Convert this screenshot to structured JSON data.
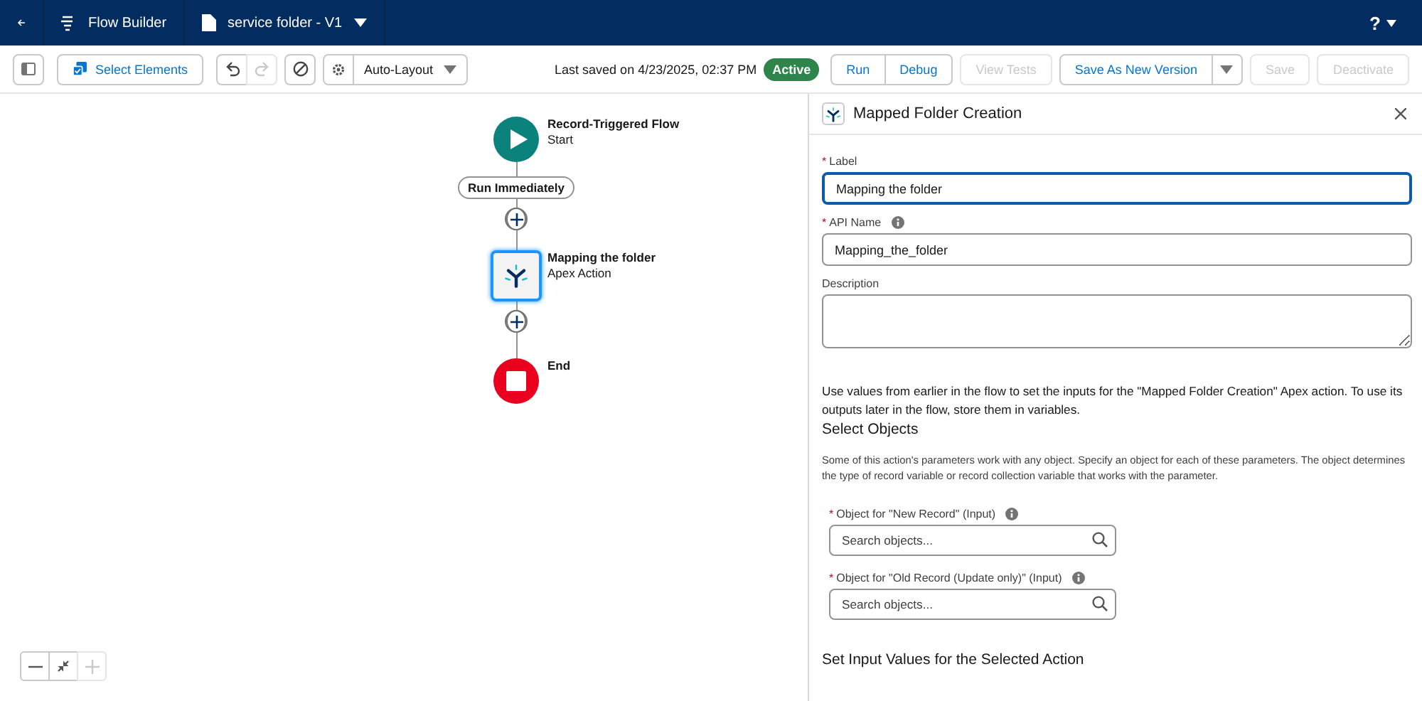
{
  "header": {
    "app_name": "Flow Builder",
    "flow_name": "service folder - V1",
    "help": "?"
  },
  "toolbar": {
    "select_elements": "Select Elements",
    "undo_disabled": false,
    "redo_disabled": true,
    "layout": "Auto-Layout",
    "last_saved": "Last saved on 4/23/2025, 02:37 PM",
    "status": "Active",
    "buttons": [
      {
        "label": "Run",
        "disabled": false,
        "joined": false
      },
      {
        "label": "Debug",
        "disabled": false,
        "joined": true
      },
      {
        "label": "View Tests",
        "disabled": true,
        "joined": false
      },
      {
        "label": "Save As New Version",
        "disabled": false,
        "joined": false
      },
      {
        "label": "Save",
        "disabled": true,
        "joined": false
      },
      {
        "label": "Deactivate",
        "disabled": true,
        "joined": false
      }
    ]
  },
  "canvas": {
    "nodes": [
      {
        "kind": "start",
        "title": "Record-Triggered Flow",
        "subtitle": "Start"
      },
      {
        "kind": "label",
        "title": "Run Immediately"
      },
      {
        "kind": "add"
      },
      {
        "kind": "action",
        "title": "Mapping the folder",
        "subtitle": "Apex Action",
        "selected": true
      },
      {
        "kind": "add"
      },
      {
        "kind": "end",
        "title": "End"
      }
    ],
    "zoom_controls": [
      {
        "kind": "out",
        "disabled": false
      },
      {
        "kind": "fit",
        "disabled": false
      },
      {
        "kind": "in",
        "disabled": true
      }
    ]
  },
  "panel": {
    "title": "Mapped Folder Creation",
    "fields": [
      {
        "required_mark": "*",
        "label": "Label",
        "info": false,
        "value": "Mapping the folder",
        "focused": true,
        "kind": "input"
      },
      {
        "required_mark": "*",
        "label": "API Name",
        "info": true,
        "value": "Mapping_the_folder",
        "focused": false,
        "kind": "input"
      },
      {
        "label": "Description",
        "info": false,
        "focused": false,
        "kind": "textarea"
      }
    ],
    "intro": "Use values from earlier in the flow to set the inputs for the \"Mapped Folder Creation\" Apex action. To use its outputs later in the flow, store them in variables.",
    "section_title": "Select Objects",
    "section_text": "Some of this action's parameters work with any object. Specify an object for each of these parameters. The object determines the type of record variable or record collection variable that works with the parameter.",
    "object_fields": [
      {
        "required_mark": "*",
        "label": "Object for \"New Record\" (Input)",
        "info": true,
        "placeholder": "Search objects..."
      },
      {
        "required_mark": "*",
        "label": "Object for \"Old Record (Update only)\" (Input)",
        "info": true,
        "placeholder": "Search objects..."
      }
    ],
    "next_section_title": "Set Input Values for the Selected Action"
  }
}
